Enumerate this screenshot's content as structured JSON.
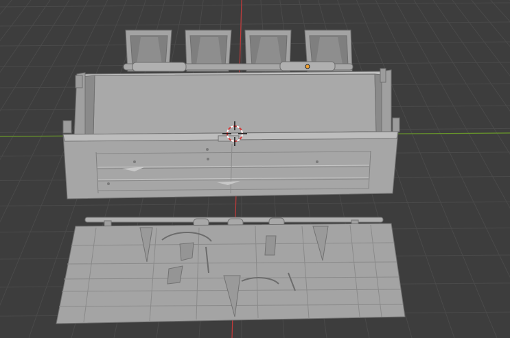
{
  "viewport": {
    "background": "#3d3d3d",
    "grid_color": "#4a4a4a",
    "axis_x_color": "#6a9a2a",
    "axis_y_color": "#c43a3a",
    "model_color": "#9a9a9a",
    "model_light": "#b4b4b4",
    "model_dark": "#7e7e7e",
    "origin_dot_color": "#f0a030",
    "cursor_color": "#d23b3b"
  },
  "objects": [
    {
      "name": "drawer-unit",
      "kind": "divided tray with four open cells"
    },
    {
      "name": "box-body",
      "kind": "open box with plank side panel"
    },
    {
      "name": "lid-panel",
      "kind": "flat plank panel with hinge rod"
    }
  ],
  "icons": [
    "3d-cursor-icon",
    "origin-point-icon"
  ]
}
